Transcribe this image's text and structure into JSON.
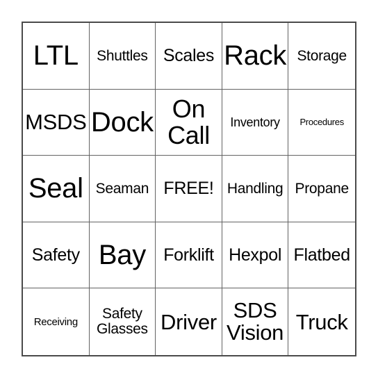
{
  "card": {
    "type": "bingo-card",
    "grid_size": 5,
    "free_space_index": 12,
    "background_color": "#ffffff",
    "text_color": "#000000",
    "border_color": "#4a4a4a",
    "gridline_color": "#636363",
    "rows": [
      [
        {
          "label": "LTL",
          "size": "sz-xxl",
          "lines": 1
        },
        {
          "label": "Shuttles",
          "size": "sz-s",
          "lines": 1
        },
        {
          "label": "Scales",
          "size": "sz-m",
          "lines": 1
        },
        {
          "label": "Rack",
          "size": "sz-xxl",
          "lines": 1
        },
        {
          "label": "Storage",
          "size": "sz-s",
          "lines": 1
        }
      ],
      [
        {
          "label": "MSDS",
          "size": "sz-l",
          "lines": 1
        },
        {
          "label": "Dock",
          "size": "sz-xxl",
          "lines": 1
        },
        {
          "label": "On\nCall",
          "size": "sz-xl",
          "lines": 2
        },
        {
          "label": "Inventory",
          "size": "sz-xs",
          "lines": 1
        },
        {
          "label": "Procedures",
          "size": "sz-min",
          "lines": 1
        }
      ],
      [
        {
          "label": "Seal",
          "size": "sz-xxl",
          "lines": 1
        },
        {
          "label": "Seaman",
          "size": "sz-s",
          "lines": 1
        },
        {
          "label": "FREE!",
          "size": "sz-m",
          "lines": 1
        },
        {
          "label": "Handling",
          "size": "sz-s",
          "lines": 1
        },
        {
          "label": "Propane",
          "size": "sz-s",
          "lines": 1
        }
      ],
      [
        {
          "label": "Safety",
          "size": "sz-m",
          "lines": 1
        },
        {
          "label": "Bay",
          "size": "sz-xxl",
          "lines": 1
        },
        {
          "label": "Forklift",
          "size": "sz-m",
          "lines": 1
        },
        {
          "label": "Hexpol",
          "size": "sz-m",
          "lines": 1
        },
        {
          "label": "Flatbed",
          "size": "sz-m",
          "lines": 1
        }
      ],
      [
        {
          "label": "Receiving",
          "size": "sz-xxs",
          "lines": 1
        },
        {
          "label": "Safety\nGlasses",
          "size": "sz-s",
          "lines": 2
        },
        {
          "label": "Driver",
          "size": "sz-l",
          "lines": 1
        },
        {
          "label": "SDS\nVision",
          "size": "sz-l",
          "lines": 2
        },
        {
          "label": "Truck",
          "size": "sz-l",
          "lines": 1
        }
      ]
    ]
  }
}
